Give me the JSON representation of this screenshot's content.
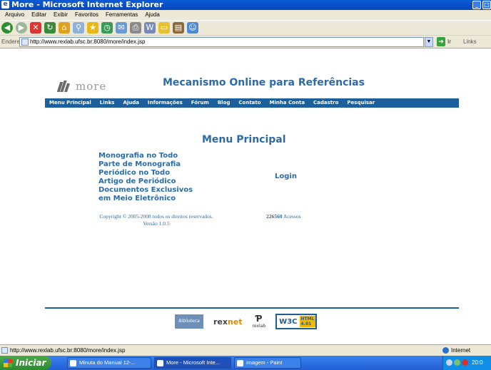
{
  "window": {
    "title": "More - Microsoft Internet Explorer",
    "buttons": [
      "_",
      "□"
    ]
  },
  "menubar": [
    "Arquivo",
    "Editar",
    "Exibir",
    "Favoritos",
    "Ferramentas",
    "Ajuda"
  ],
  "address": {
    "label": "Endereço",
    "url": "http://www.rexlab.ufsc.br:8080/more/index.jsp",
    "go_label": "Ir",
    "links_label": "Links"
  },
  "site": {
    "logo_text": "more",
    "title": "Mecanismo Online para Referências",
    "nav": [
      "Menu Principal",
      "Links",
      "Ajuda",
      "Informações",
      "Fórum",
      "Blog",
      "Contato",
      "Minha Conta",
      "Cadastro",
      "Pesquisar"
    ],
    "heading": "Menu Principal",
    "menu_items": [
      "Monografia no Todo",
      "Parte de Monografia",
      "Periódico no Todo",
      "Artigo de Periódico",
      "Documentos Exclusivos",
      "em Meio Eletrônico"
    ],
    "login_label": "Login",
    "copyright": "Copyright © 2005-2008 todos os direitos reservados.",
    "version": "Versão 1.0.5",
    "counter_value": "226560",
    "counter_label": "Acessos",
    "footer": {
      "bib_label": "Biblioteca",
      "rexnet_a": "rex",
      "rexnet_b": "net",
      "rexlab_label": "rexlab",
      "w3c_label": "W3C",
      "w3c_badge": "HTML 4.01"
    }
  },
  "status": {
    "url": "http://www.rexlab.ufsc.br:8080/more/index.jsp",
    "zone": "Internet"
  },
  "taskbar": {
    "start_label": "Iniciar",
    "tasks": [
      "Minuta do Manual 12-...",
      "More - Microsoft Inte...",
      "imagem - Paint"
    ],
    "clock": "20:0"
  }
}
